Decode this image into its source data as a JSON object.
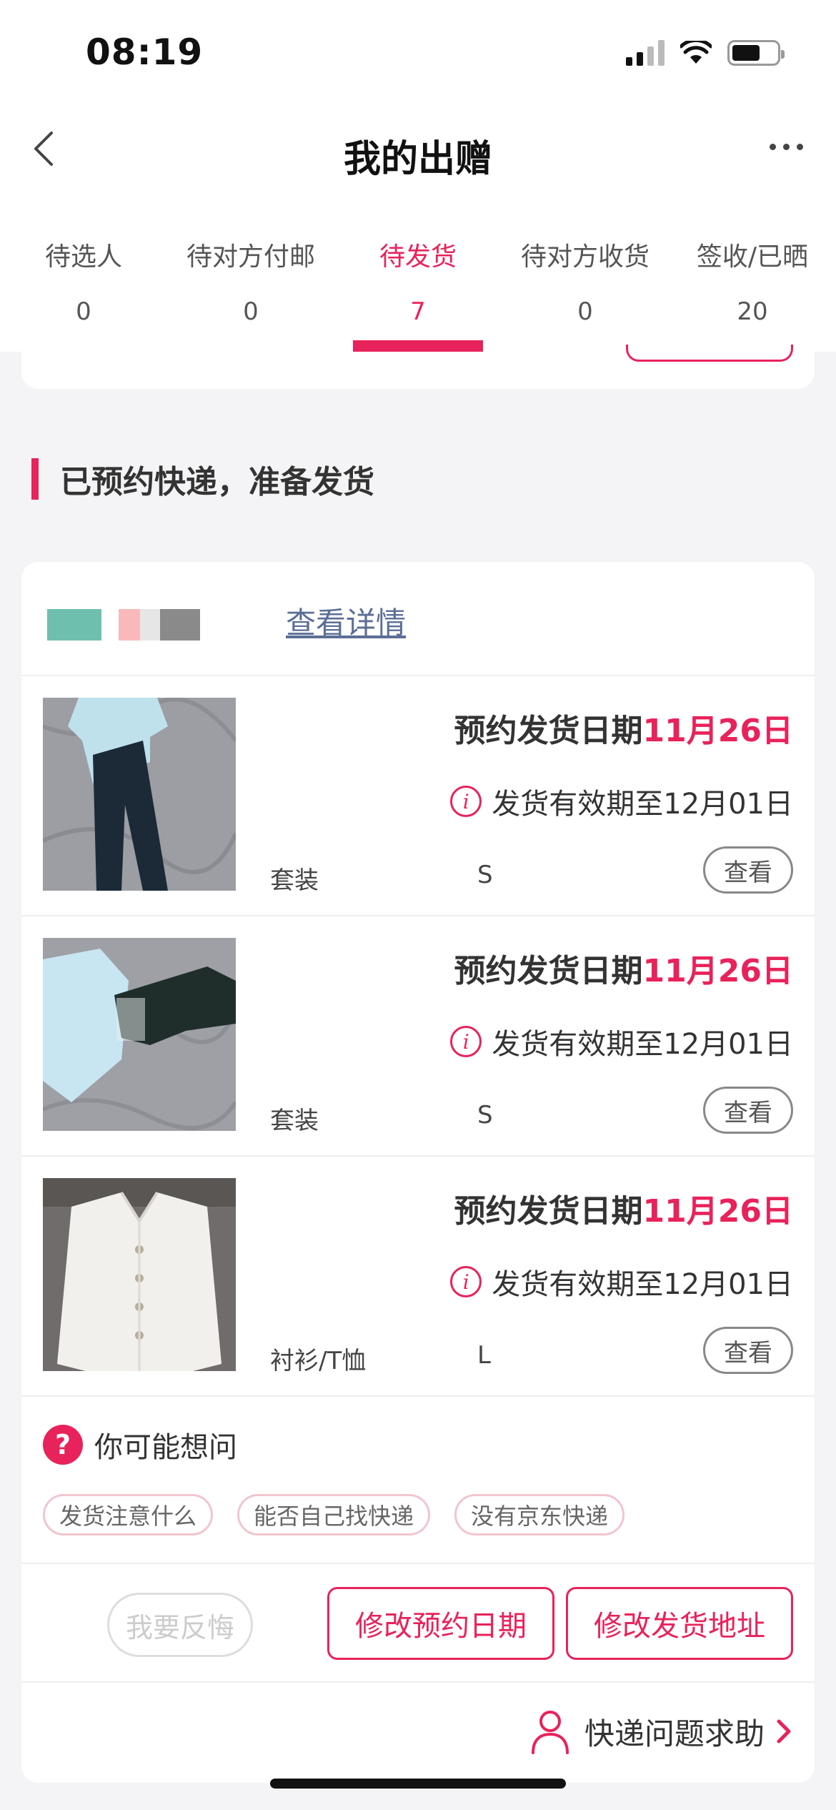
{
  "status_bar": {
    "time": "08:19"
  },
  "nav": {
    "title": "我的出赠"
  },
  "tabs": [
    {
      "label": "待选人",
      "count": "0",
      "active": false
    },
    {
      "label": "待对方付邮",
      "count": "0",
      "active": false
    },
    {
      "label": "待发货",
      "count": "7",
      "active": true
    },
    {
      "label": "待对方收货",
      "count": "0",
      "active": false
    },
    {
      "label": "签收/已晒",
      "count": "20",
      "active": false
    }
  ],
  "section": {
    "heading": "已预约快递，准备发货"
  },
  "card": {
    "detail_link": "查看详情",
    "items": [
      {
        "date_label": "预约发货日期",
        "date_value": "11月26日",
        "validity": "发货有效期至12月01日",
        "category": "套装",
        "size": "S",
        "view_label": "查看"
      },
      {
        "date_label": "预约发货日期",
        "date_value": "11月26日",
        "validity": "发货有效期至12月01日",
        "category": "套装",
        "size": "S",
        "view_label": "查看"
      },
      {
        "date_label": "预约发货日期",
        "date_value": "11月26日",
        "validity": "发货有效期至12月01日",
        "category": "衬衫/T恤",
        "size": "L",
        "view_label": "查看"
      }
    ],
    "faq": {
      "title": "你可能想问",
      "chips": [
        "发货注意什么",
        "能否自己找快递",
        "没有京东快递"
      ]
    },
    "actions": {
      "regret": "我要反悔",
      "change_date": "修改预约日期",
      "change_address": "修改发货地址"
    },
    "help": {
      "label": "快递问题求助"
    }
  },
  "colors": {
    "accent": "#e8225a",
    "link": "#5b6e96",
    "background": "#f4f4f6"
  }
}
